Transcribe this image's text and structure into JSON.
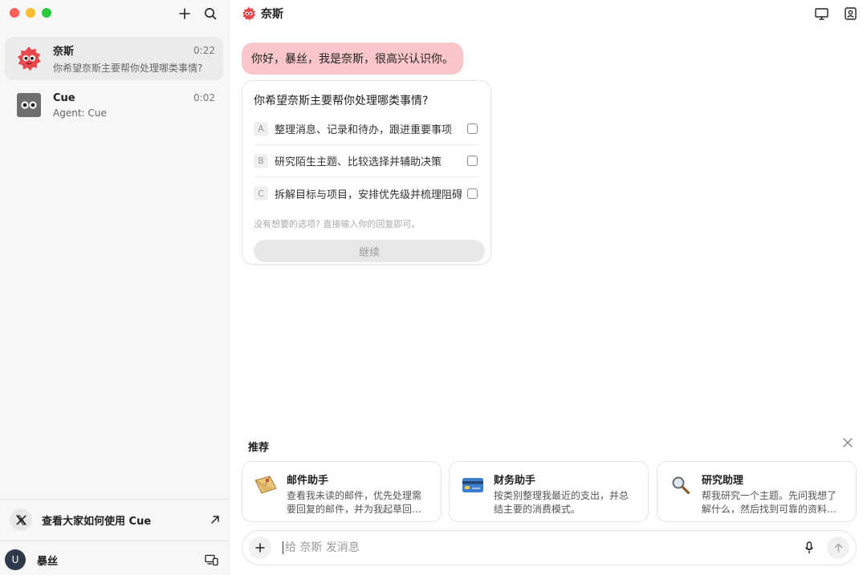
{
  "sidebar": {
    "chats": [
      {
        "name": "奈斯",
        "time": "0:22",
        "preview": "你希望奈斯主要帮你处理哪类事情?",
        "avatar_icon": "red-monster-avatar-icon"
      },
      {
        "name": "Cue",
        "time": "0:02",
        "preview": "Agent: Cue",
        "avatar_icon": "cue-robot-avatar-icon"
      }
    ],
    "x_link_label": "查看大家如何使用 Cue",
    "user": {
      "initial": "U",
      "name": "暴丝"
    }
  },
  "header": {
    "title": "奈斯"
  },
  "conversation": {
    "greeting": "你好，暴丝，我是奈斯，很高兴认识你。",
    "quiz": {
      "question": "你希望奈斯主要帮你处理哪类事情?",
      "options": [
        {
          "letter": "A",
          "text": "整理消息、记录和待办，跟进重要事项"
        },
        {
          "letter": "B",
          "text": "研究陌生主题、比较选择并辅助决策"
        },
        {
          "letter": "C",
          "text": "拆解目标与项目，安排优先级并梳理阻碍"
        }
      ],
      "hint": "没有想要的选项? 直接输入你的回复即可。",
      "continue_label": "继续"
    }
  },
  "recommendations": {
    "header": "推荐",
    "cards": [
      {
        "title": "邮件助手",
        "desc": "查看我未读的邮件，优先处理需要回复的邮件，并为我起草回复供…",
        "icon": "letter-icon"
      },
      {
        "title": "财务助手",
        "desc": "按类别整理我最近的支出，并总结主要的消费模式。",
        "icon": "credit-card-icon"
      },
      {
        "title": "研究助理",
        "desc": "帮我研究一个主题。先问我想了解什么，然后找到可靠的资料来源…",
        "icon": "magnifier-icon"
      }
    ]
  },
  "composer": {
    "placeholder": "给 奈斯 发消息"
  },
  "colors": {
    "greeting_bubble": "#f9c7c9",
    "brand_red": "#e8474c"
  }
}
